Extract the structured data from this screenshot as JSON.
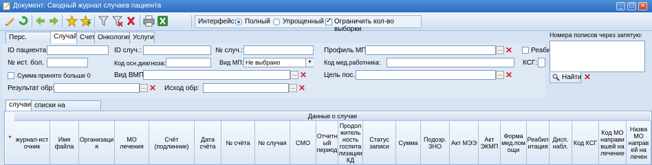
{
  "window": {
    "title": "Документ: Сводный журнал случаев пациента",
    "buttons": [
      "_",
      "□",
      "×"
    ]
  },
  "toolbar": {
    "interface_label": "Интерфейс:",
    "mode_full": "Полный",
    "mode_simple": "Упрощенный",
    "mode_selected": "full",
    "limit_label": "Ограничить кол-во выборки",
    "limit_checked": true
  },
  "tabs": [
    "Перс. данные",
    "Случай",
    "Счет",
    "Онкология",
    "Услуги"
  ],
  "active_tab": "Случай",
  "form": {
    "patient_id": "ID пациента:",
    "case_id": "ID случ.:",
    "case_no": "№ случ.:",
    "profile_mp": "Профиль МП:",
    "rehab": "Реаби",
    "history_no": "№ ист. бол.",
    "diag_code": "Код осн.диагноза:",
    "vid_mp": "Вид МП:",
    "vid_mp_value": "Не выбрано",
    "med_worker": "Код мед.работника:",
    "ksg": "КСГ:",
    "sum_more_zero": "Сумма принято больше 0",
    "vid_vmp": "Вид ВМП:",
    "goal": "Цель пос.:",
    "result": "Результат обр:",
    "outcome": "Исход обр:"
  },
  "right_panel": {
    "polis_label": "Номера полисов через запятую:",
    "find_button": "Найти"
  },
  "subtabs": [
    "случаи",
    "списки на диспансериз."
  ],
  "active_subtab": "случаи",
  "grid": {
    "group_header": "Данные о случае",
    "row_indicator": "*",
    "columns": [
      "журнал-ист очник",
      "Имя файла",
      "Организаци я",
      "МО лечения",
      "Счёт (подлинник)",
      "Дата счёта",
      "№ счёта",
      "№ случая",
      "СМО",
      "Отчетн ый период",
      "Продол житель ность госпита лизации КД",
      "Статус записи",
      "Сумма",
      "Подозр. ЗНО",
      "Акт МЭЭ",
      "Акт ЭКМП",
      "Форма мед.пом ощи",
      "Реабил итация",
      "Дисп. набл.",
      "Код КСГ",
      "Код МО направи вшей на лечение",
      "Назва МО направ ей на лечен"
    ]
  },
  "colors": {
    "title_bar": "#2f6cc0",
    "background": "#d6e3f3",
    "clear_icon": "#d0202a"
  }
}
